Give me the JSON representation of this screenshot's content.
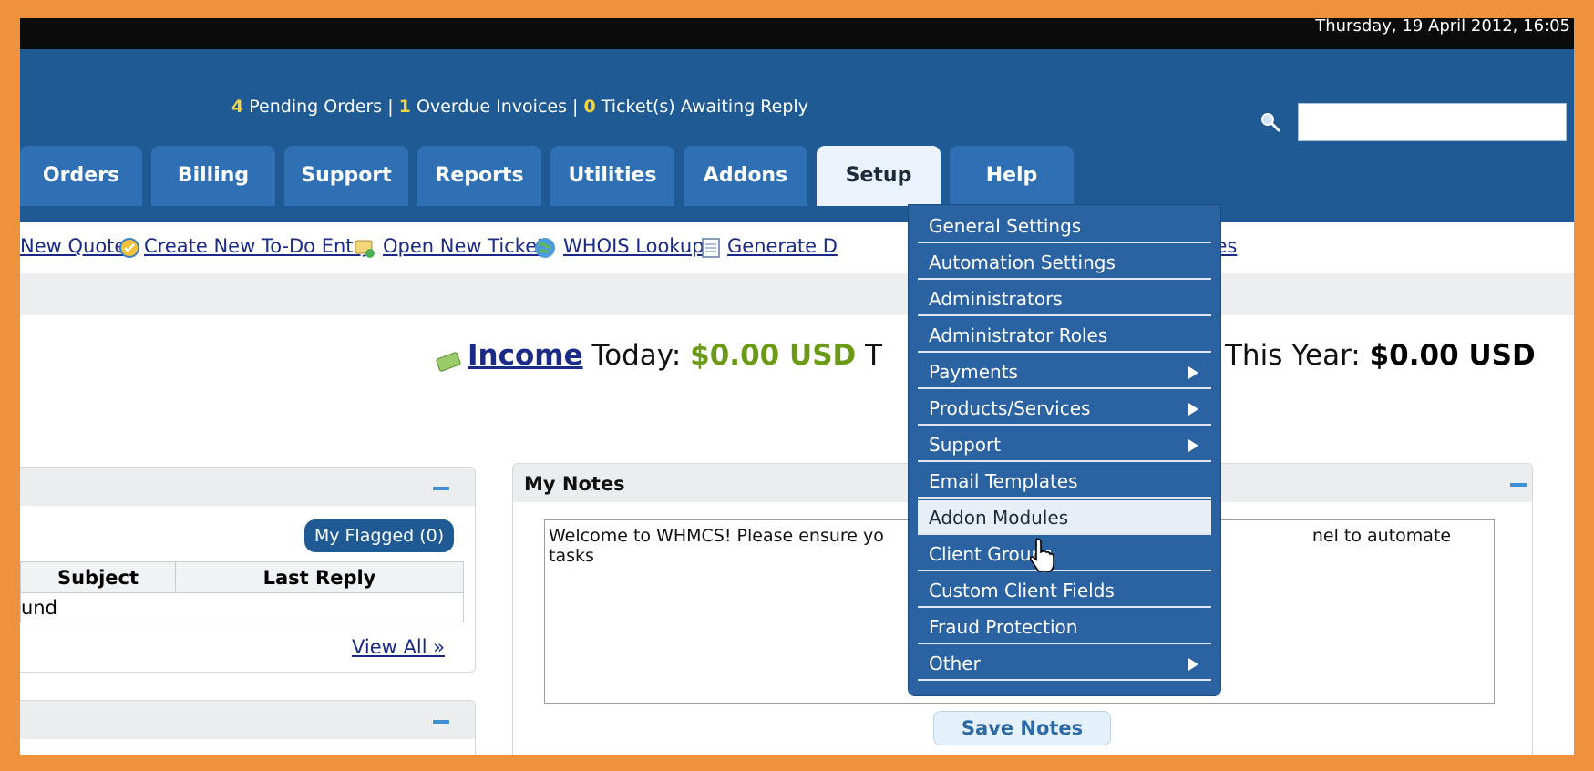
{
  "topbar": {
    "date": "Thursday, 19 April 2012, 16:05"
  },
  "header": {
    "pending_count": "4",
    "pending_label": "Pending Orders",
    "overdue_count": "1",
    "overdue_label": "Overdue Invoices",
    "tickets_count": "0",
    "tickets_label": "Ticket(s) Awaiting Reply",
    "separator": "|"
  },
  "tabs": [
    "Orders",
    "Billing",
    "Support",
    "Reports",
    "Utilities",
    "Addons",
    "Setup",
    "Help"
  ],
  "active_tab": "Setup",
  "shortcuts": {
    "new_quote": "New Quote",
    "create_todo": "Create New To-Do Entry",
    "open_ticket": "Open New Ticket",
    "whois": "WHOIS Lookup",
    "generate": "Generate D",
    "features_tail": "ures"
  },
  "income": {
    "link": "Income",
    "today_label": "Today:",
    "today_value": "$0.00 USD",
    "trailing": "T",
    "year_label": "This Year:",
    "year_value": "$0.00 USD"
  },
  "tickets_panel": {
    "flagged_button": "My Flagged (0)",
    "columns": [
      "Subject",
      "Last Reply"
    ],
    "empty_row": "und",
    "view_all": "View All »"
  },
  "notes": {
    "title": "My Notes",
    "text_left": "Welcome to WHMCS!  Please ensure yo",
    "text_right": "nel to automate tasks",
    "save_button": "Save Notes"
  },
  "setup_menu": {
    "items": [
      {
        "label": "General Settings",
        "submenu": false
      },
      {
        "label": "Automation Settings",
        "submenu": false
      },
      {
        "label": "Administrators",
        "submenu": false
      },
      {
        "label": "Administrator Roles",
        "submenu": false
      },
      {
        "label": "Payments",
        "submenu": true
      },
      {
        "label": "Products/Services",
        "submenu": true
      },
      {
        "label": "Support",
        "submenu": true
      },
      {
        "label": "Email Templates",
        "submenu": false
      },
      {
        "label": "Addon Modules",
        "submenu": false,
        "hover": true
      },
      {
        "label": "Client Groups",
        "submenu": false
      },
      {
        "label": "Custom Client Fields",
        "submenu": false
      },
      {
        "label": "Fraud Protection",
        "submenu": false
      },
      {
        "label": "Other",
        "submenu": true
      }
    ]
  },
  "colors": {
    "frame": "#f0913c",
    "header_blue": "#1f5a94",
    "tab_blue": "#2f6fb3",
    "stat_yellow": "#f4d43a",
    "money_green": "#6b9a16"
  },
  "icons": [
    "search-icon",
    "todo-icon",
    "ticket-icon",
    "globe-icon",
    "report-icon",
    "money-icon",
    "pointer-cursor-icon"
  ]
}
